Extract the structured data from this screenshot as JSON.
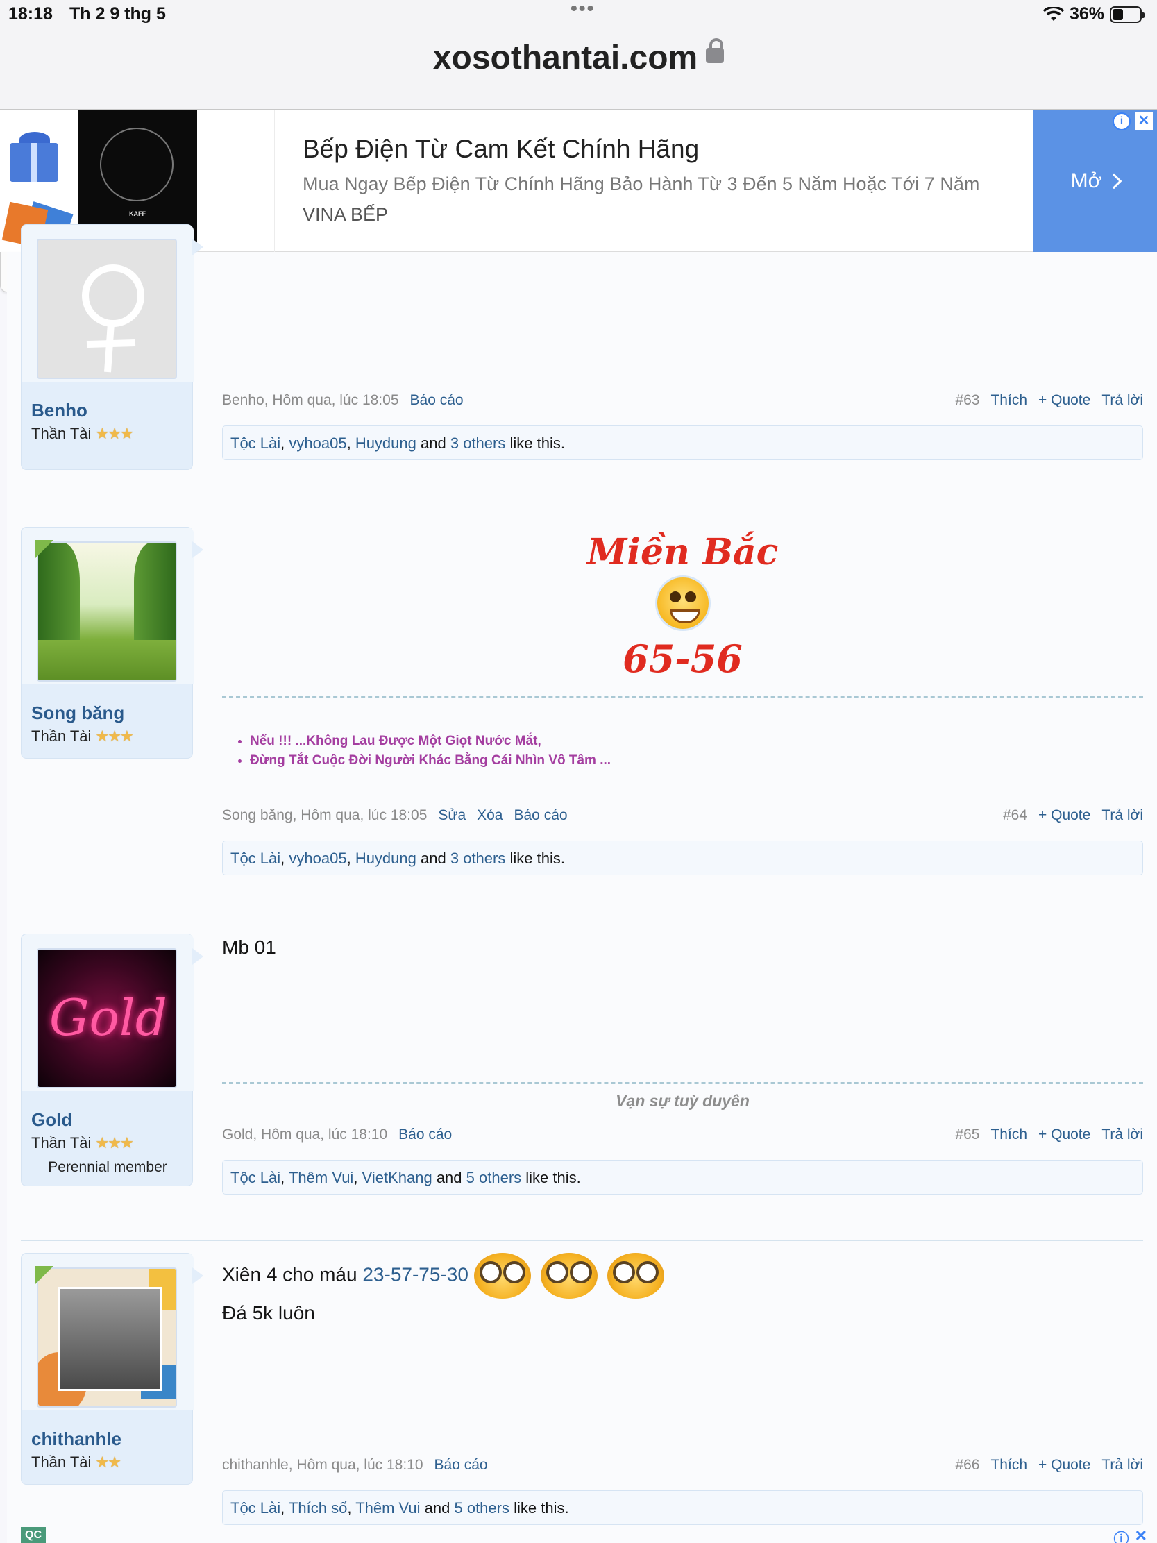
{
  "status": {
    "time": "18:18",
    "date": "Th 2 9 thg 5",
    "battery": "36%"
  },
  "url": "xosothantai.com",
  "ad": {
    "title": "Bếp Điện Từ Cam Kết Chính Hãng",
    "desc": "Mua Ngay Bếp Điện Từ Chính Hãng Bảo Hành Từ 3 Đến 5 Năm Hoặc Tới 7 Năm",
    "sponsor": "VINA BẾP",
    "button": "Mở",
    "cooktop_brand": "KAFF"
  },
  "posts": [
    {
      "username": "Benho",
      "title": "Thần Tài",
      "stars": "★★★",
      "meta_left": "Benho, Hôm qua, lúc 18:05",
      "report": "Báo cáo",
      "num": "#63",
      "like": "Thích",
      "quote": "+ Quote",
      "reply": "Trả lời",
      "likers": [
        "Tộc Lài",
        "vyhoa05",
        "Huydung"
      ],
      "and": "and",
      "others": "3 others",
      "like_this": "like this."
    },
    {
      "username": "Song băng",
      "title": "Thần Tài",
      "stars": "★★★",
      "sig_region": "Miền Bắc",
      "sig_numbers": "65-56",
      "sig_lines": [
        "Nếu !!! ...Không Lau Được Một Giọt Nước Mắt,",
        "Đừng Tắt Cuộc Đời Người Khác Bằng Cái Nhìn Vô Tâm ..."
      ],
      "meta_left": "Song băng, Hôm qua, lúc 18:05",
      "edit": "Sửa",
      "delete": "Xóa",
      "report": "Báo cáo",
      "num": "#64",
      "quote": "+ Quote",
      "reply": "Trả lời",
      "likers": [
        "Tộc Lài",
        "vyhoa05",
        "Huydung"
      ],
      "and": "and",
      "others": "3 others",
      "like_this": "like this."
    },
    {
      "username": "Gold",
      "title": "Thần Tài",
      "stars": "★★★",
      "tag": "Perennial member",
      "avatar_text": "Gold",
      "body": "Mb 01",
      "sig": "Vạn sự tuỳ duyên",
      "meta_left": "Gold, Hôm qua, lúc 18:10",
      "report": "Báo cáo",
      "num": "#65",
      "like": "Thích",
      "quote": "+ Quote",
      "reply": "Trả lời",
      "likers": [
        "Tộc Lài",
        "Thêm Vui",
        "VietKhang"
      ],
      "and": "and",
      "others": "5 others",
      "like_this": "like this."
    },
    {
      "username": "chithanhle",
      "title": "Thần Tài",
      "stars": "★★",
      "body_prefix": "Xiên 4 cho máu ",
      "body_link": "23-57-75-30",
      "body_line2": "Đá 5k luôn",
      "meta_left": "chithanhle, Hôm qua, lúc 18:10",
      "report": "Báo cáo",
      "num": "#66",
      "like": "Thích",
      "quote": "+ Quote",
      "reply": "Trả lời",
      "likers": [
        "Tộc Lài",
        "Thích số",
        "Thêm Vui"
      ],
      "and": "and",
      "others": "5 others",
      "like_this": "like this."
    }
  ],
  "footer_ad_label": "QC"
}
